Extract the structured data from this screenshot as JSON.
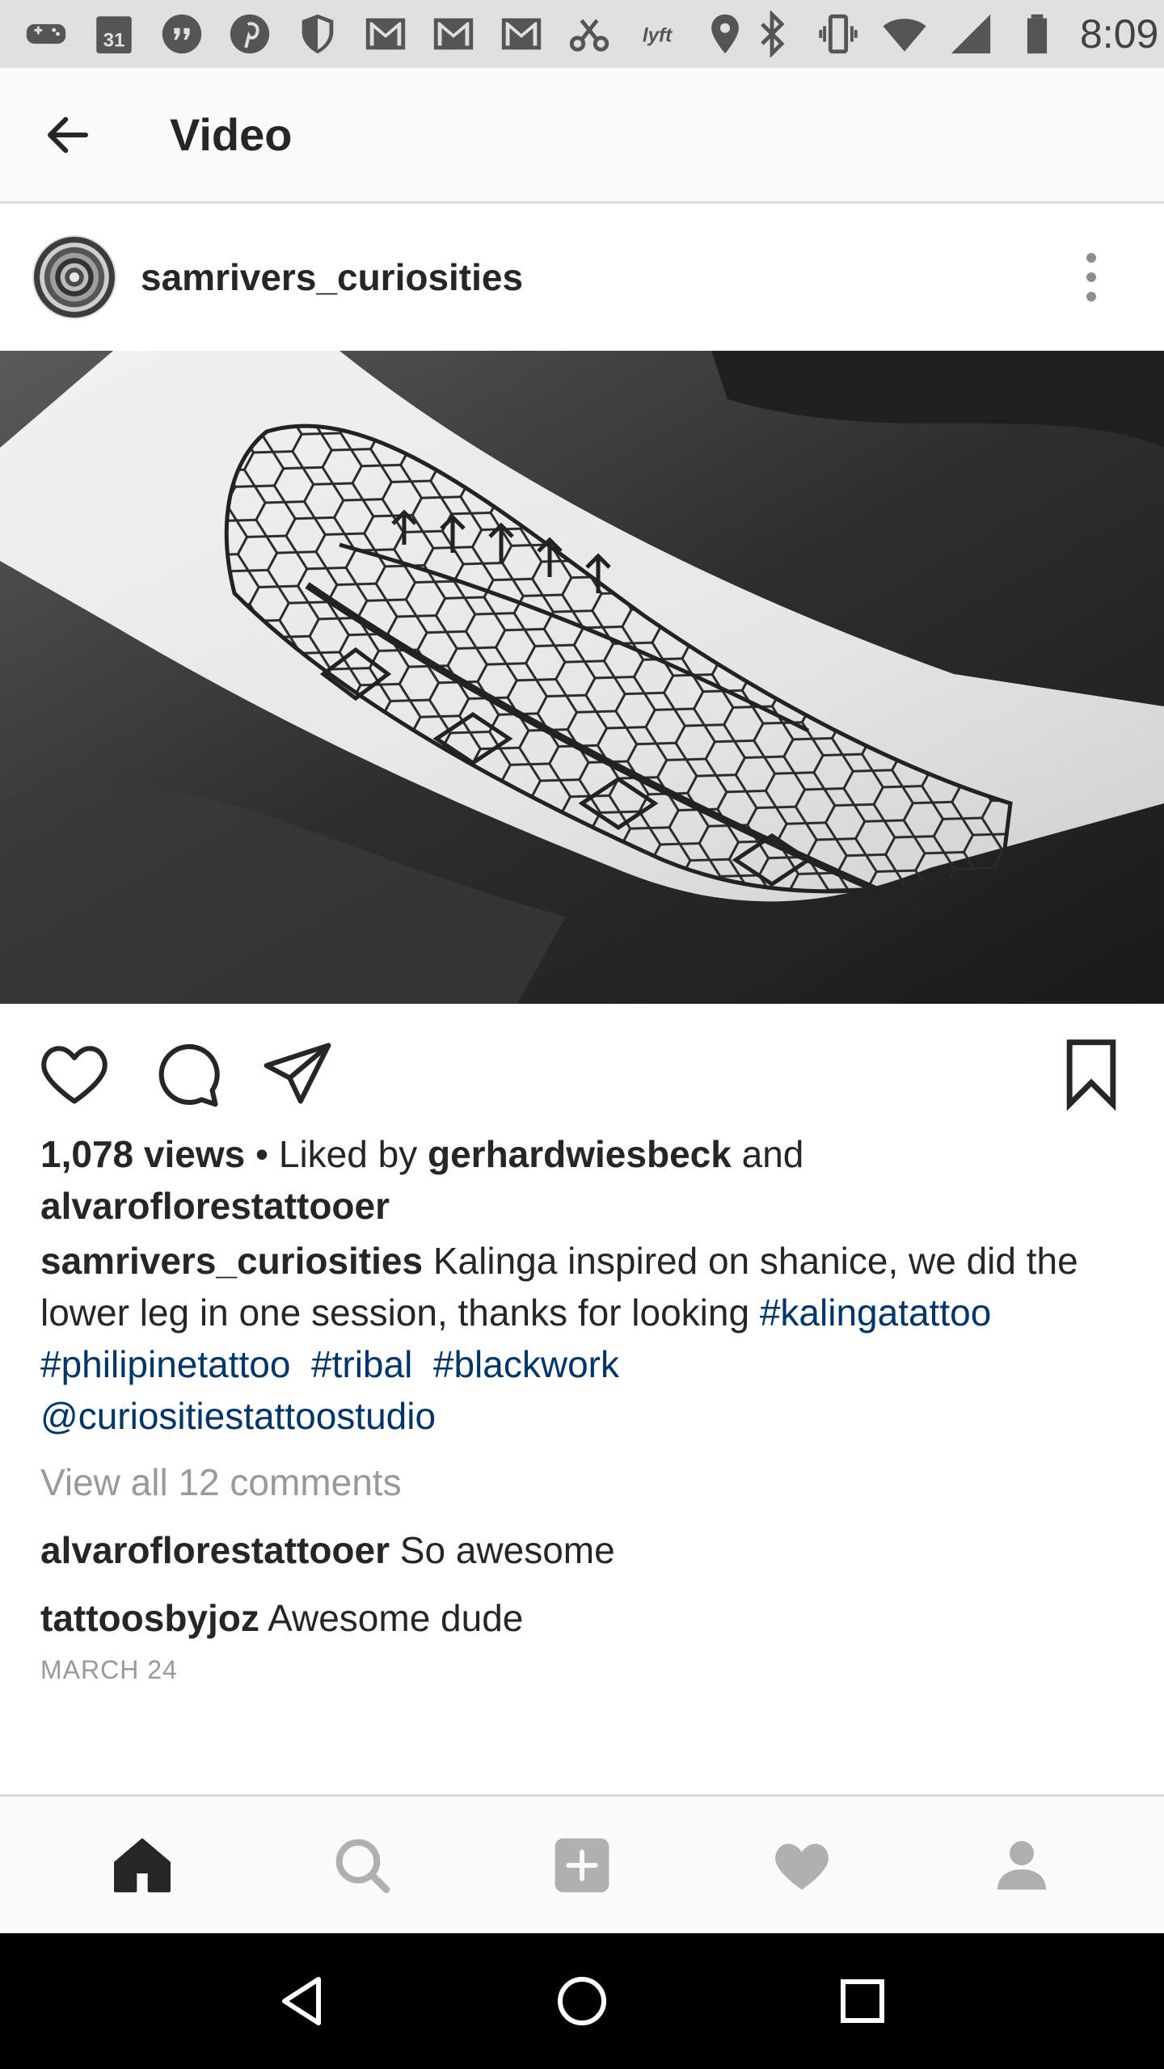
{
  "status_bar": {
    "time": "8:09",
    "calendar_day": "31",
    "icons": [
      "gamepad-icon",
      "calendar-icon",
      "quote-icon",
      "pinterest-icon",
      "shield-icon",
      "gmail-icon",
      "gmail-icon",
      "gmail-icon",
      "scissors-icon",
      "lyft-icon",
      "location-icon",
      "bluetooth-icon",
      "vibrate-icon",
      "wifi-icon",
      "signal-icon",
      "battery-icon"
    ]
  },
  "app_bar": {
    "title": "Video",
    "back_icon": "arrow-left-icon"
  },
  "post": {
    "username": "samrivers_curiosities",
    "more_icon": "more-vertical-icon",
    "views": "1,078 views",
    "liked_by_prefix": " • Liked by ",
    "liked_by_user1": "gerhardwiesbeck",
    "liked_by_and": " and",
    "liked_by_user2": "alvaroflorestattooer",
    "caption_user": "samrivers_curiosities",
    "caption_text": " Kalinga inspired on shanice, we did the lower leg in one session, thanks for looking ",
    "hashtags": [
      "#kalingatattoo",
      "#philipinetattoo",
      "#tribal",
      "#blackwork"
    ],
    "mention": "@curiositiestattoostudio",
    "view_all_comments": "View all 12 comments",
    "comments": [
      {
        "user": "alvaroflorestattooer",
        "text": " So awesome"
      },
      {
        "user": "tattoosbyjoz",
        "text": " Awesome dude"
      }
    ],
    "date": "MARCH 24"
  },
  "actions": {
    "like_icon": "heart-outline-icon",
    "comment_icon": "comment-icon",
    "share_icon": "send-icon",
    "save_icon": "bookmark-icon"
  },
  "bottom_nav": [
    "home-icon",
    "search-icon",
    "add-icon",
    "activity-heart-icon",
    "profile-icon"
  ],
  "system_nav": [
    "back-triangle-icon",
    "home-circle-icon",
    "recents-square-icon"
  ],
  "colors": {
    "text": "#262626",
    "link": "#003569",
    "muted": "#999999",
    "bar_bg": "#fafafa",
    "status_bg": "#e0e0e0"
  }
}
